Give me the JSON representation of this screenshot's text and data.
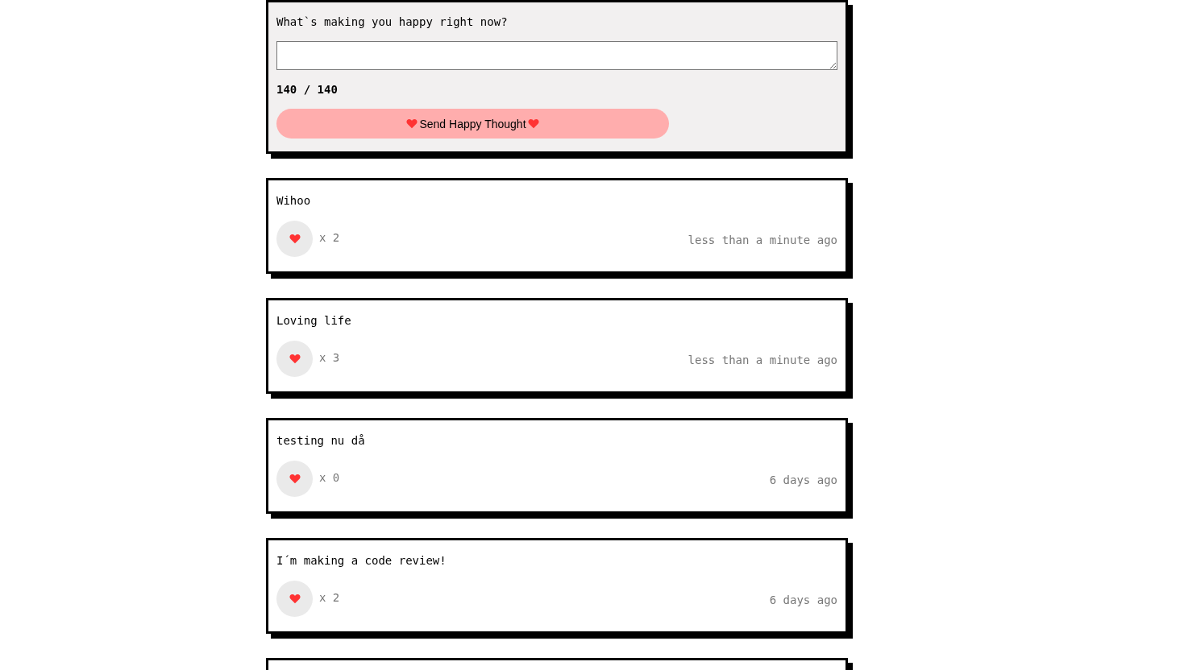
{
  "form": {
    "question": "What`s making you happy right now?",
    "counter": "140 / 140",
    "button": "Send Happy Thought"
  },
  "thoughts": [
    {
      "message": "Wihoo",
      "likes": "x 2",
      "time": "less than a minute ago"
    },
    {
      "message": "Loving life",
      "likes": "x 3",
      "time": "less than a minute ago"
    },
    {
      "message": "testing nu då",
      "likes": "x 0",
      "time": "6 days ago"
    },
    {
      "message": "I´m making a code review!",
      "likes": "x 2",
      "time": "6 days ago"
    }
  ]
}
